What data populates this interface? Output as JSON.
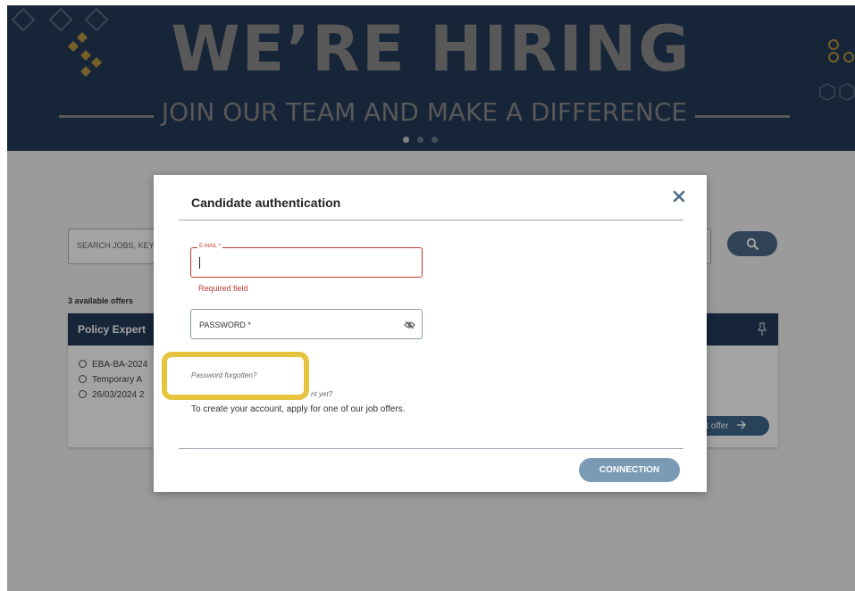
{
  "banner": {
    "title": "WE’RE HIRING",
    "subtitle": "JOIN OUR TEAM AND MAKE A DIFFERENCE",
    "slides": 3,
    "active_slide": 1
  },
  "search": {
    "placeholder": "SEARCH JOBS, KEYW"
  },
  "offers": {
    "count_label": "3 available offers",
    "items": [
      {
        "title": "Policy Expert",
        "reference": "EBA-BA-2024",
        "contract": "Temporary A",
        "date": "26/03/2024 2",
        "detail_label": "lt offer"
      }
    ]
  },
  "modal": {
    "title": "Candidate authentication",
    "email_label": "E-MAIL *",
    "email_value": "",
    "email_error": "Required field",
    "password_label": "PASSWORD *",
    "forgot_link": "Password forgotten?",
    "no_account_fragment": "nt yet?",
    "create_account_text": "To create your account, apply for one of our job offers.",
    "connection_label": "CONNECTION"
  },
  "colors": {
    "banner_bg": "#243b5a",
    "error": "#c0392b",
    "highlight": "#e6c440",
    "button": "#7a9ab5"
  },
  "icons": [
    "search-icon",
    "pin-icon",
    "close-icon",
    "eye-off-icon",
    "info-icon",
    "arrow-right-icon"
  ]
}
